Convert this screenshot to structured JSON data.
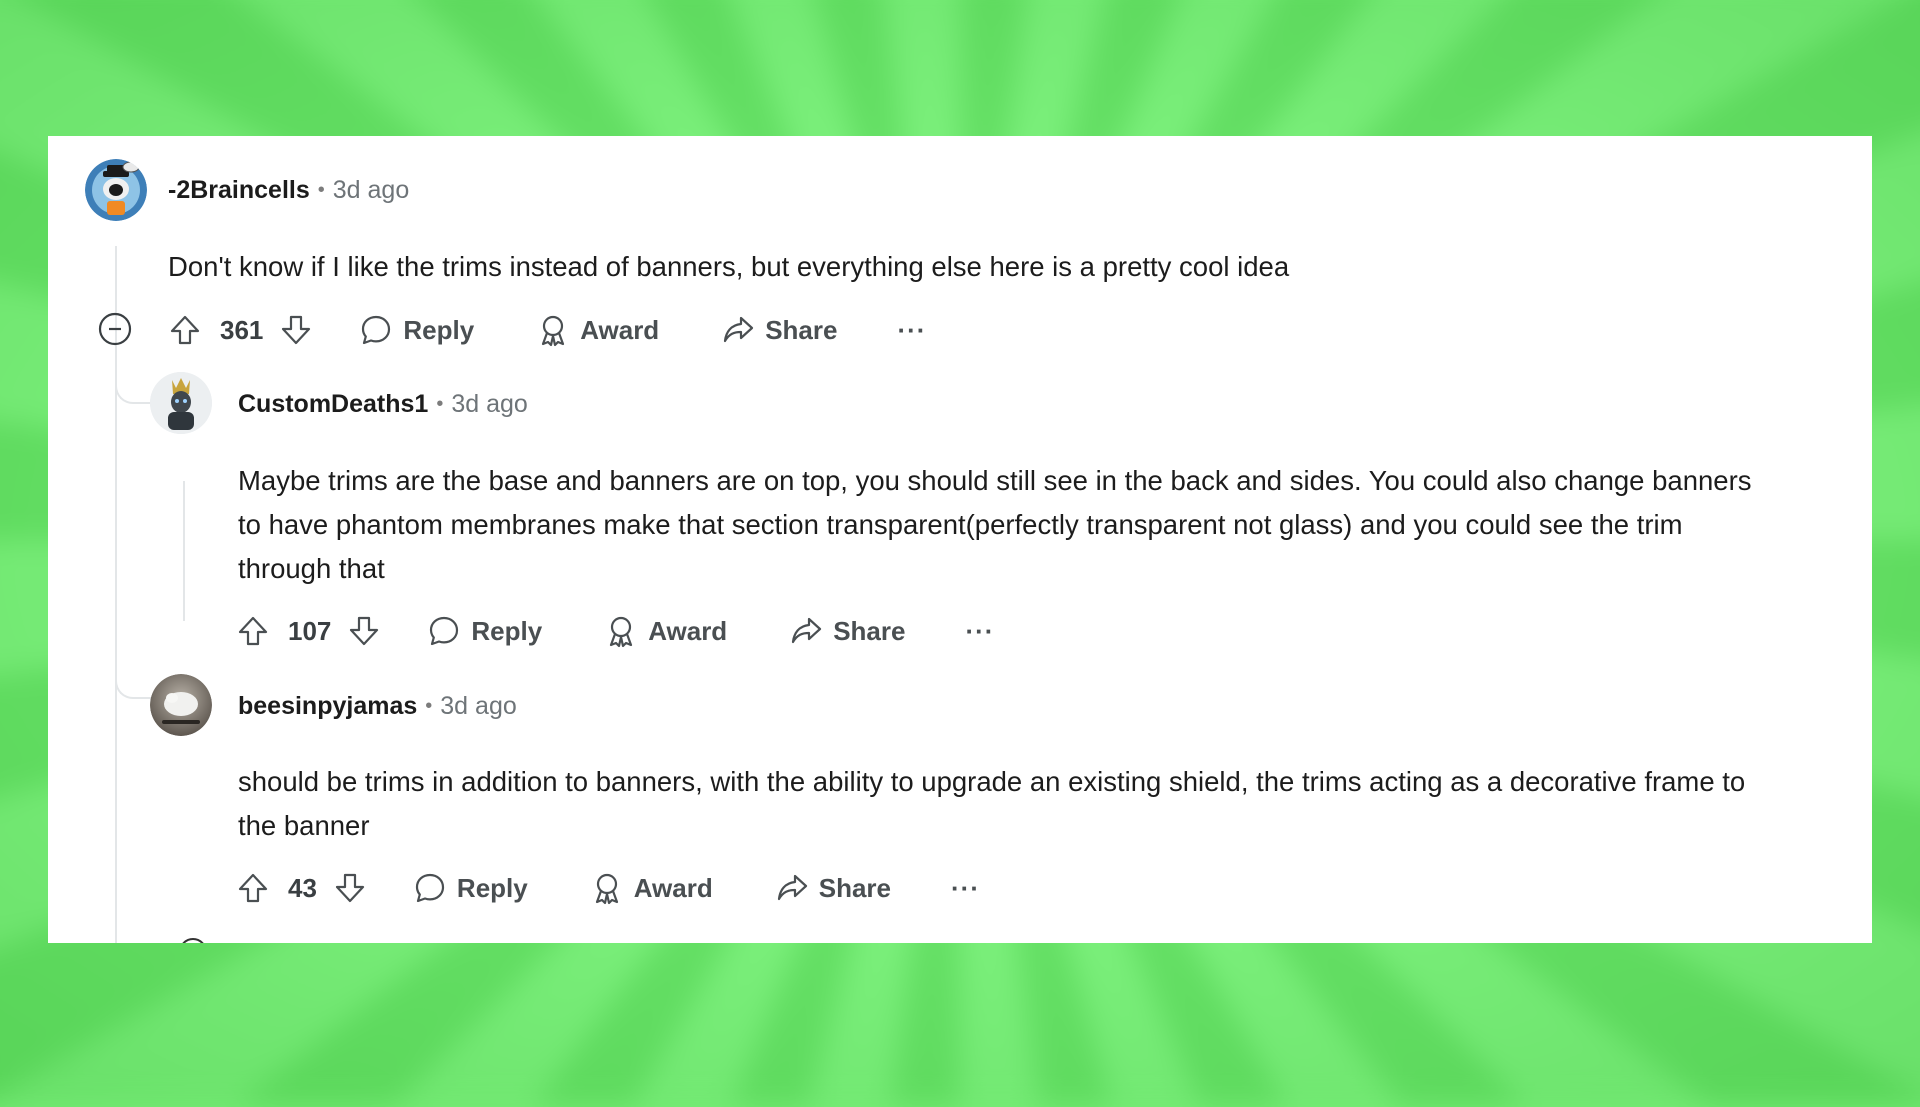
{
  "comments": [
    {
      "username": "-2Braincells",
      "separator": "•",
      "time": "3d ago",
      "text": "Don't know if I like the trims instead of banners, but everything else here is a pretty cool idea",
      "score": "361",
      "reply_label": "Reply",
      "award_label": "Award",
      "share_label": "Share",
      "more_label": "···"
    },
    {
      "username": "CustomDeaths1",
      "separator": "•",
      "time": "3d ago",
      "text": "Maybe trims are the base and banners are on top, you should still see in the back and sides. You could also change banners to have phantom membranes make that section transparent(perfectly transparent not glass) and you could see the trim through that",
      "score": "107",
      "reply_label": "Reply",
      "award_label": "Award",
      "share_label": "Share",
      "more_label": "···"
    },
    {
      "username": "beesinpyjamas",
      "separator": "•",
      "time": "3d ago",
      "text": "should be trims in addition to banners, with the ability to upgrade an existing shield, the trims acting as a decorative frame to the banner",
      "score": "43",
      "reply_label": "Reply",
      "award_label": "Award",
      "share_label": "Share",
      "more_label": "···"
    }
  ],
  "icons": {
    "collapse": "minus-circle-icon",
    "upvote": "arrow-up-icon",
    "downvote": "arrow-down-icon",
    "reply": "speech-bubble-icon",
    "award": "award-ribbon-icon",
    "share": "share-arrow-icon"
  },
  "colors": {
    "background_green": "#74ec74",
    "card": "#ffffff",
    "text": "#1c1c1c",
    "muted": "#6e7478",
    "thread_line": "#e3e6e8"
  }
}
